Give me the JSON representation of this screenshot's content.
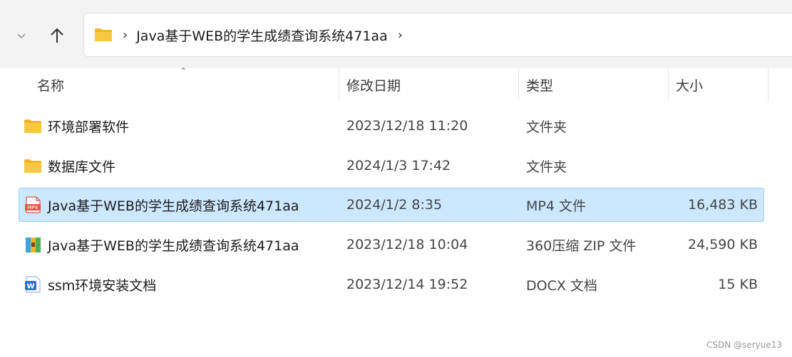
{
  "address": {
    "path": "Java基于WEB的学生成绩查询系统471aa",
    "separator": "›"
  },
  "columns": {
    "name": "名称",
    "date": "修改日期",
    "type": "类型",
    "size": "大小"
  },
  "files": [
    {
      "name": "环境部署软件",
      "date": "2023/12/18 11:20",
      "type": "文件夹",
      "size": "",
      "icon": "folder-icon"
    },
    {
      "name": "数据库文件",
      "date": "2024/1/3 17:42",
      "type": "文件夹",
      "size": "",
      "icon": "folder-icon"
    },
    {
      "name": "Java基于WEB的学生成绩查询系统471aa",
      "date": "2024/1/2 8:35",
      "type": "MP4 文件",
      "size": "16,483 KB",
      "icon": "mp4-file-icon",
      "selected": true
    },
    {
      "name": "Java基于WEB的学生成绩查询系统471aa",
      "date": "2023/12/18 10:04",
      "type": "360压缩 ZIP 文件",
      "size": "24,590 KB",
      "icon": "zip-archive-icon"
    },
    {
      "name": "ssm环境安装文档",
      "date": "2023/12/14 19:52",
      "type": "DOCX 文档",
      "size": "15 KB",
      "icon": "docx-file-icon"
    }
  ],
  "watermark": "CSDN @seryue13",
  "colors": {
    "selection": "#cce8ff",
    "selection_border": "#99d1ff",
    "folder": "#f5c242"
  }
}
